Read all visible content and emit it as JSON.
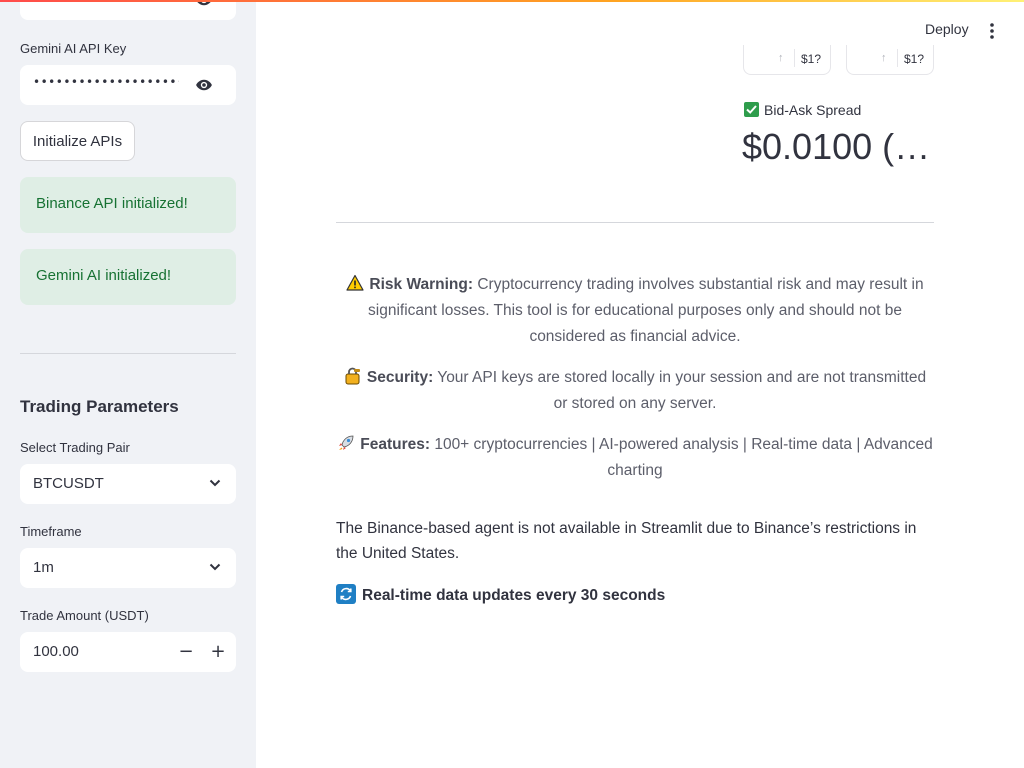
{
  "sidebar": {
    "gemini_label": "Gemini AI API Key",
    "top_key_dots": "•••••••••••••••••••••••••••••••••••",
    "gemini_key_dots": "•••••••••••••••••••••••••••••••••••",
    "init_button": "Initialize APIs",
    "binance_success": "Binance API initialized!",
    "gemini_success": "Gemini AI initialized!",
    "params_heading": "Trading Parameters",
    "pair_label": "Select Trading Pair",
    "pair_value": "BTCUSDT",
    "timeframe_label": "Timeframe",
    "timeframe_value": "1m",
    "amount_label": "Trade Amount (USDT)",
    "amount_value": "100.00",
    "minus": "−",
    "plus": "+"
  },
  "header": {
    "deploy": "Deploy"
  },
  "main": {
    "mini_cards": [
      {
        "arrow": "↑",
        "value": "$1?"
      },
      {
        "arrow": "↑",
        "value": "$1?"
      }
    ],
    "spread_label": "Bid-Ask Spread",
    "spread_value": "$0.0100 (0…",
    "risk_title": "Risk Warning:",
    "risk_text": " Cryptocurrency trading involves substantial risk and may result in significant losses. This tool is for educational purposes only and should not be considered as financial advice.",
    "security_title": "Security:",
    "security_text": " Your API keys are stored locally in your session and are not transmitted or stored on any server.",
    "features_title": "Features:",
    "features_text": " 100+ cryptocurrencies | AI-powered analysis | Real-time data | Advanced charting",
    "note": "The Binance-based agent is not available in Streamlit due to Binance’s restrictions in the United States.",
    "update_text": "Real-time data updates every 30 seconds"
  },
  "colors": {
    "sidebar_bg": "#f0f2f6",
    "success_bg": "#dfeee5",
    "success_text": "#177233",
    "text": "#31333f",
    "accent": "#ff4b4b"
  }
}
